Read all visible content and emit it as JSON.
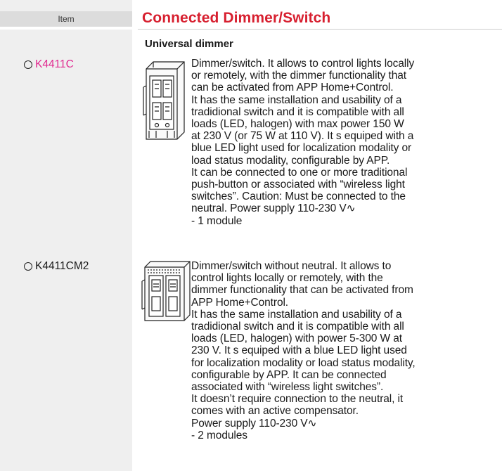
{
  "header": {
    "item_label": "Item",
    "section_title": "Connected Dimmer/Switch"
  },
  "subheading": "Universal dimmer",
  "products": [
    {
      "code": "K4411C",
      "code_color": "#e0298f",
      "image_icon": "dimmer-module-icon",
      "lines": [
        "Dimmer/switch. It allows to control lights locally",
        "or remotely, with the dimmer functionality that",
        "can be activated from APP Home+Control.",
        "It  has the same installation and usability of a",
        "tradidional switch and it is compatible with all",
        "loads (LED, halogen) with max power 150 W",
        "at 230 V (or 75 W at 110 V). It s equiped with a",
        "blue LED light used for localization modality or",
        "load status modality, configurable by APP.",
        "It can be connected to one or more traditional",
        "push-button or associated with “wireless light",
        "switches”. Caution: Must be connected to the",
        "neutral. Power supply 110-230 V∿",
        "- 1 module"
      ]
    },
    {
      "code": "K4411CM2",
      "code_color": "#1a1a1a",
      "image_icon": "dimmer-2-module-icon",
      "lines": [
        "Dimmer/switch without neutral. It allows to",
        "control lights locally or remotely, with the",
        "dimmer functionality that can be activated from",
        "APP Home+Control.",
        "It  has the same installation and usability of a",
        "tradidional switch and it is compatible with all",
        "loads (LED, halogen) with power 5-300 W at",
        "230 V. It s equiped with a blue LED light used",
        "for localization modality or load status modality,",
        "configurable by APP. It can be connected",
        "associated with “wireless light switches”.",
        "It doesn’t require connection to the neutral, it",
        "comes with an active compensator.",
        "Power supply 110-230 V∿",
        "- 2 modules"
      ]
    }
  ]
}
